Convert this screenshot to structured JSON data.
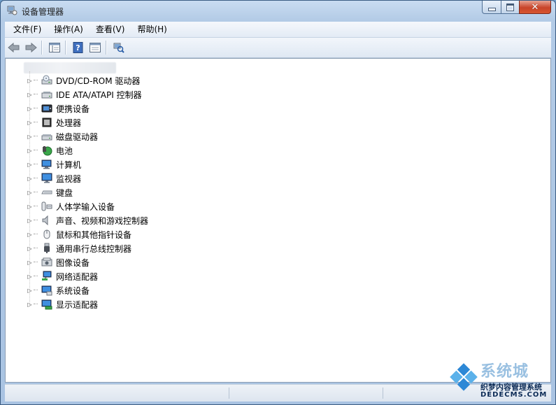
{
  "window": {
    "title": "设备管理器",
    "close_symbol": "✕"
  },
  "menu": [
    {
      "label": "文件(F)"
    },
    {
      "label": "操作(A)"
    },
    {
      "label": "查看(V)"
    },
    {
      "label": "帮助(H)"
    }
  ],
  "toolbar": {
    "buttons": [
      "back-arrow-icon",
      "forward-arrow-icon",
      "console-tree-icon",
      "help-icon",
      "properties-icon",
      "scan-hardware-icon"
    ]
  },
  "tree": {
    "root_label": "",
    "items": [
      {
        "label": "DVD/CD-ROM 驱动器",
        "icon": "dvd-drive-icon"
      },
      {
        "label": "IDE ATA/ATAPI 控制器",
        "icon": "ide-controller-icon"
      },
      {
        "label": "便携设备",
        "icon": "portable-device-icon"
      },
      {
        "label": "处理器",
        "icon": "processor-icon"
      },
      {
        "label": "磁盘驱动器",
        "icon": "disk-drive-icon"
      },
      {
        "label": "电池",
        "icon": "battery-icon"
      },
      {
        "label": "计算机",
        "icon": "computer-icon"
      },
      {
        "label": "监视器",
        "icon": "monitor-icon"
      },
      {
        "label": "键盘",
        "icon": "keyboard-icon"
      },
      {
        "label": "人体学输入设备",
        "icon": "hid-icon"
      },
      {
        "label": "声音、视频和游戏控制器",
        "icon": "sound-icon"
      },
      {
        "label": "鼠标和其他指针设备",
        "icon": "mouse-icon"
      },
      {
        "label": "通用串行总线控制器",
        "icon": "usb-icon"
      },
      {
        "label": "图像设备",
        "icon": "imaging-device-icon"
      },
      {
        "label": "网络适配器",
        "icon": "network-adapter-icon"
      },
      {
        "label": "系统设备",
        "icon": "system-device-icon"
      },
      {
        "label": "显示适配器",
        "icon": "display-adapter-icon"
      }
    ]
  },
  "watermark": {
    "line1": "系统城",
    "line2": "织梦内容管理系统",
    "line3": "DEDECMS.COM"
  }
}
